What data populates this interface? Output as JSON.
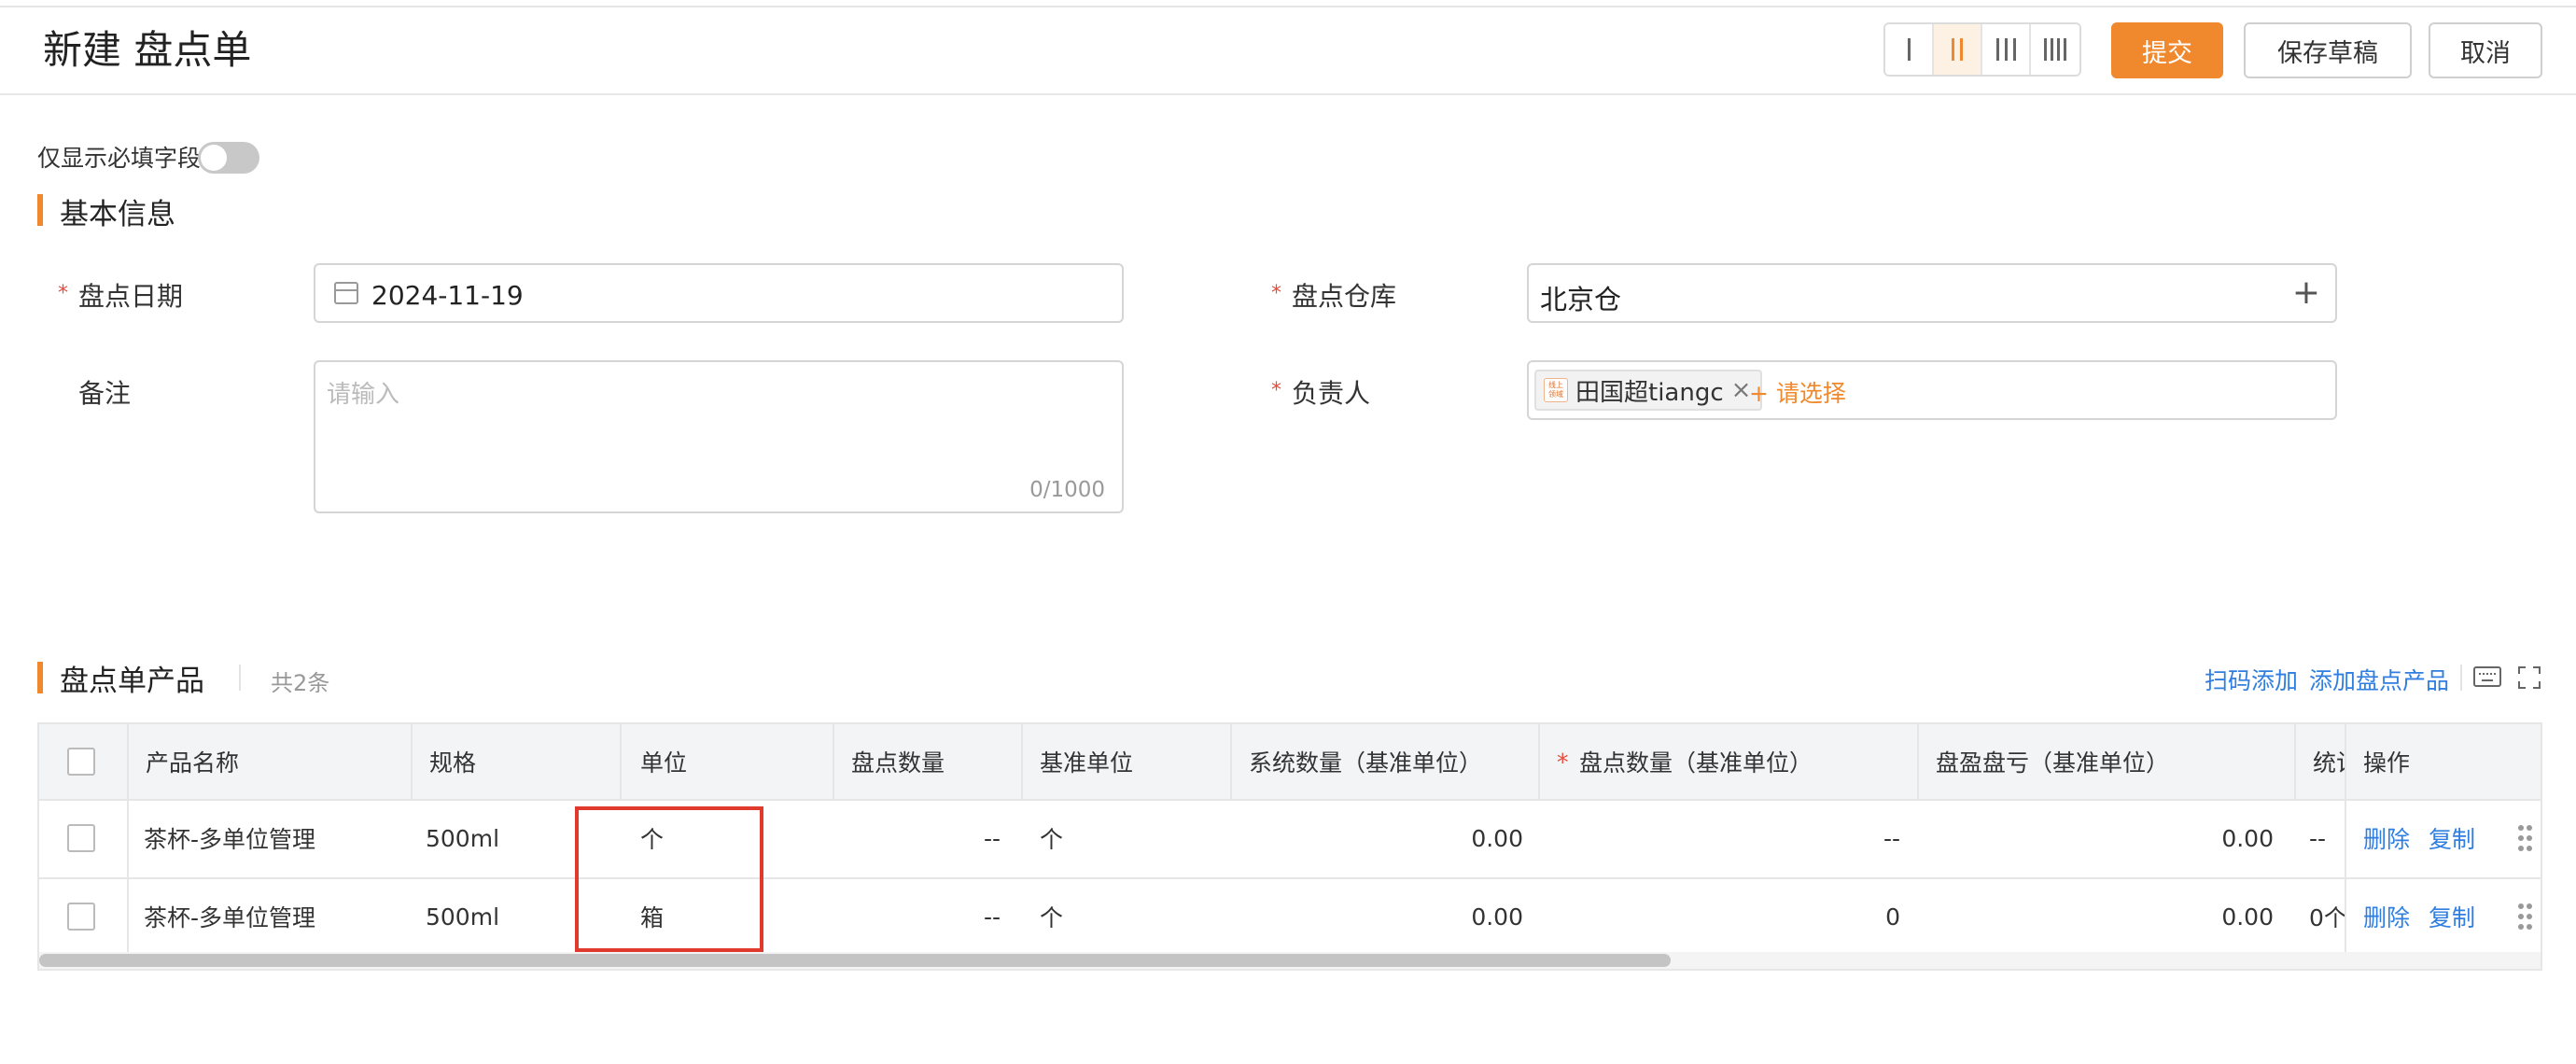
{
  "header": {
    "title": "新建 盘点单",
    "buttons": {
      "submit": "提交",
      "save_draft": "保存草稿",
      "cancel": "取消"
    }
  },
  "required_toggle": {
    "label": "仅显示必填字段",
    "on": false
  },
  "basic_info": {
    "section_title": "基本信息",
    "date": {
      "label": "盘点日期",
      "value": "2024-11-19"
    },
    "warehouse": {
      "label": "盘点仓库",
      "value": "北京仓"
    },
    "remark": {
      "label": "备注",
      "placeholder": "请输入",
      "counter": "0/1000"
    },
    "owner": {
      "label": "负责人",
      "tag_name": "田国超tiangc",
      "avatar_text": "线上 领域",
      "add_label": "+ 请选择"
    }
  },
  "products": {
    "section_title": "盘点单产品",
    "count_label": "共2条",
    "scan_add": "扫码添加",
    "add_product": "添加盘点产品",
    "columns": [
      "产品名称",
      "规格",
      "单位",
      "盘点数量",
      "基准单位",
      "系统数量（基准单位）",
      "盘点数量（基准单位）",
      "盘盈盘亏（基准单位）",
      "统计",
      "操作"
    ],
    "rows": [
      {
        "name": "茶杯-多单位管理",
        "spec": "500ml",
        "unit": "个",
        "count": "--",
        "base_unit": "个",
        "system_qty": "0.00",
        "count_base": "--",
        "diff": "0.00",
        "stat": "--",
        "delete": "删除",
        "copy": "复制"
      },
      {
        "name": "茶杯-多单位管理",
        "spec": "500ml",
        "unit": "箱",
        "count": "--",
        "base_unit": "个",
        "system_qty": "0.00",
        "count_base": "0",
        "diff": "0.00",
        "stat": "0个",
        "delete": "删除",
        "copy": "复制"
      }
    ]
  },
  "colors": {
    "accent": "#f0892d",
    "link": "#2f7ee0",
    "required": "#e74c3c",
    "highlight": "#e03a2f"
  }
}
